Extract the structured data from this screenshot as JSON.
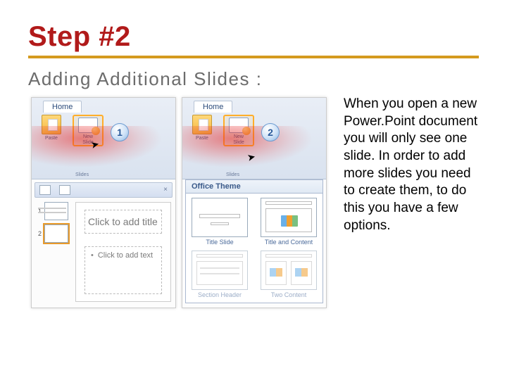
{
  "title": "Step #2",
  "subtitle": "Adding Additional Slides :",
  "description": "When you open a new Power.Point document you will only see one slide. In order to add more slides you need to create them, to do this you have a few options.",
  "ribbon": {
    "tab": "Home",
    "paste": "Paste",
    "new_slide": "New\nSlide",
    "group_slides": "Slides"
  },
  "shot1": {
    "callout": "1",
    "thumb1": "1",
    "thumb2": "2",
    "placeholder_title": "Click to add title",
    "placeholder_body": "Click to add text"
  },
  "shot2": {
    "callout": "2",
    "gallery_header": "Office Theme",
    "layouts": {
      "title_slide": "Title Slide",
      "title_content": "Title and Content",
      "section_header": "Section Header",
      "two_content": "Two Content"
    }
  }
}
